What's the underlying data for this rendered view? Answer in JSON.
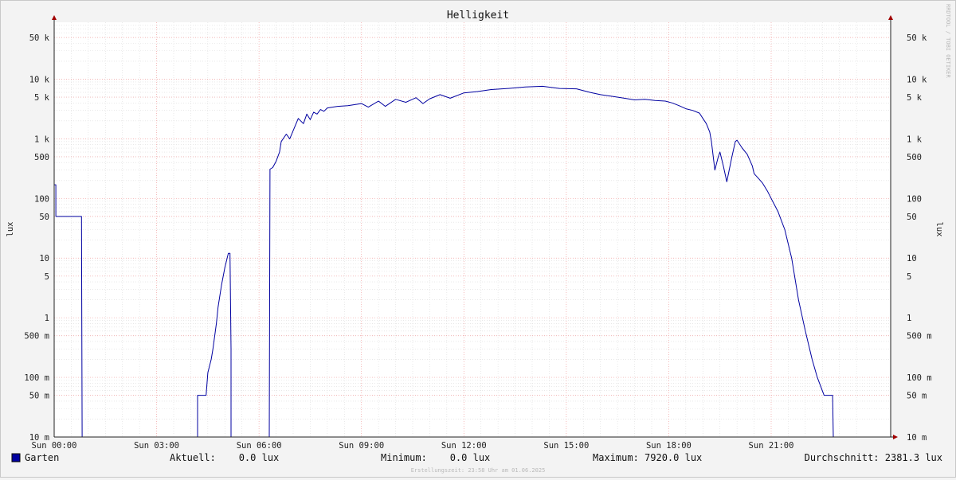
{
  "chart_data": {
    "type": "line",
    "title": "Helligkeit",
    "ylabel": "lux",
    "ylabel_right": "lux",
    "y_scale": "log",
    "ylim": [
      0.01,
      90000
    ],
    "xlim": [
      0,
      24.5
    ],
    "grid": true,
    "y_ticks": [
      {
        "v": 0.01,
        "label": "10 m"
      },
      {
        "v": 0.05,
        "label": "50 m"
      },
      {
        "v": 0.1,
        "label": "100 m"
      },
      {
        "v": 0.5,
        "label": "500 m"
      },
      {
        "v": 1,
        "label": "1"
      },
      {
        "v": 5,
        "label": "5"
      },
      {
        "v": 10,
        "label": "10"
      },
      {
        "v": 50,
        "label": "50"
      },
      {
        "v": 100,
        "label": "100"
      },
      {
        "v": 500,
        "label": "500"
      },
      {
        "v": 1000,
        "label": "1 k"
      },
      {
        "v": 5000,
        "label": "5 k"
      },
      {
        "v": 10000,
        "label": "10 k"
      },
      {
        "v": 50000,
        "label": "50 k"
      }
    ],
    "x_ticks": [
      {
        "v": 0,
        "label": "Sun 00:00"
      },
      {
        "v": 3,
        "label": "Sun 03:00"
      },
      {
        "v": 6,
        "label": "Sun 06:00"
      },
      {
        "v": 9,
        "label": "Sun 09:00"
      },
      {
        "v": 12,
        "label": "Sun 12:00"
      },
      {
        "v": 15,
        "label": "Sun 15:00"
      },
      {
        "v": 18,
        "label": "Sun 18:00"
      },
      {
        "v": 21,
        "label": "Sun 21:00"
      }
    ],
    "series": [
      {
        "name": "Garten",
        "color": "#0000a0",
        "x": [
          0,
          0.05,
          0.05,
          0.8,
          0.82,
          4.2,
          4.2,
          4.45,
          4.5,
          4.6,
          4.65,
          4.75,
          4.8,
          4.9,
          5.0,
          5.1,
          5.15,
          5.18,
          5.18,
          5.2,
          5.2,
          6.3,
          6.32,
          6.4,
          6.5,
          6.6,
          6.65,
          6.8,
          6.9,
          7.05,
          7.15,
          7.3,
          7.4,
          7.5,
          7.6,
          7.7,
          7.8,
          7.9,
          8.0,
          8.3,
          8.6,
          9.0,
          9.2,
          9.5,
          9.7,
          10.0,
          10.3,
          10.6,
          10.8,
          11.0,
          11.3,
          11.6,
          12.0,
          12.4,
          12.8,
          13.3,
          13.8,
          14.3,
          14.8,
          15.3,
          15.7,
          16.0,
          16.3,
          16.7,
          17.0,
          17.3,
          17.6,
          17.9,
          18.1,
          18.3,
          18.5,
          18.7,
          18.9,
          19.0,
          19.1,
          19.2,
          19.25,
          19.35,
          19.45,
          19.5,
          19.6,
          19.7,
          19.85,
          19.95,
          20.0,
          20.15,
          20.3,
          20.45,
          20.5,
          20.65,
          20.75,
          20.9,
          21.0,
          21.2,
          21.4,
          21.6,
          21.8,
          22.0,
          22.2,
          22.35,
          22.55,
          22.7,
          22.75,
          22.8,
          22.82,
          23.6,
          23.62,
          24.0
        ],
        "y": [
          170,
          170,
          50,
          50,
          0.01,
          0.01,
          0.05,
          0.05,
          0.12,
          0.2,
          0.3,
          0.8,
          1.5,
          3.5,
          7,
          12,
          12,
          0.3,
          0.01,
          0.01,
          0.01,
          0.01,
          310,
          330,
          420,
          600,
          900,
          1200,
          1000,
          1600,
          2200,
          1800,
          2600,
          2100,
          2800,
          2600,
          3100,
          2900,
          3300,
          3500,
          3600,
          3900,
          3400,
          4300,
          3500,
          4600,
          4100,
          4900,
          3900,
          4700,
          5500,
          4800,
          5900,
          6200,
          6700,
          7000,
          7400,
          7600,
          7000,
          6900,
          6000,
          5500,
          5200,
          4800,
          4500,
          4600,
          4400,
          4300,
          4000,
          3600,
          3200,
          3000,
          2700,
          2200,
          1800,
          1300,
          900,
          300,
          500,
          600,
          350,
          190,
          500,
          900,
          950,
          700,
          550,
          350,
          260,
          210,
          180,
          130,
          100,
          60,
          30,
          10,
          2,
          0.6,
          0.2,
          0.1,
          0.05,
          0.05,
          0.05,
          0.05,
          0.01,
          0.01,
          0.01,
          0.01
        ]
      }
    ]
  },
  "legend": {
    "series_name": "Garten",
    "swatch_color": "#0000a0",
    "aktuell": "Aktuell:    0.0 lux",
    "minimum": "Minimum:    0.0 lux",
    "maximum": "Maximum: 7920.0 lux",
    "durchschnitt": "Durchschnitt: 2381.3 lux"
  },
  "footer": "Erstellungszeit: 23:58 Uhr am 01.06.2025",
  "watermark": "RRDTOOL / TOBI OETIKER"
}
